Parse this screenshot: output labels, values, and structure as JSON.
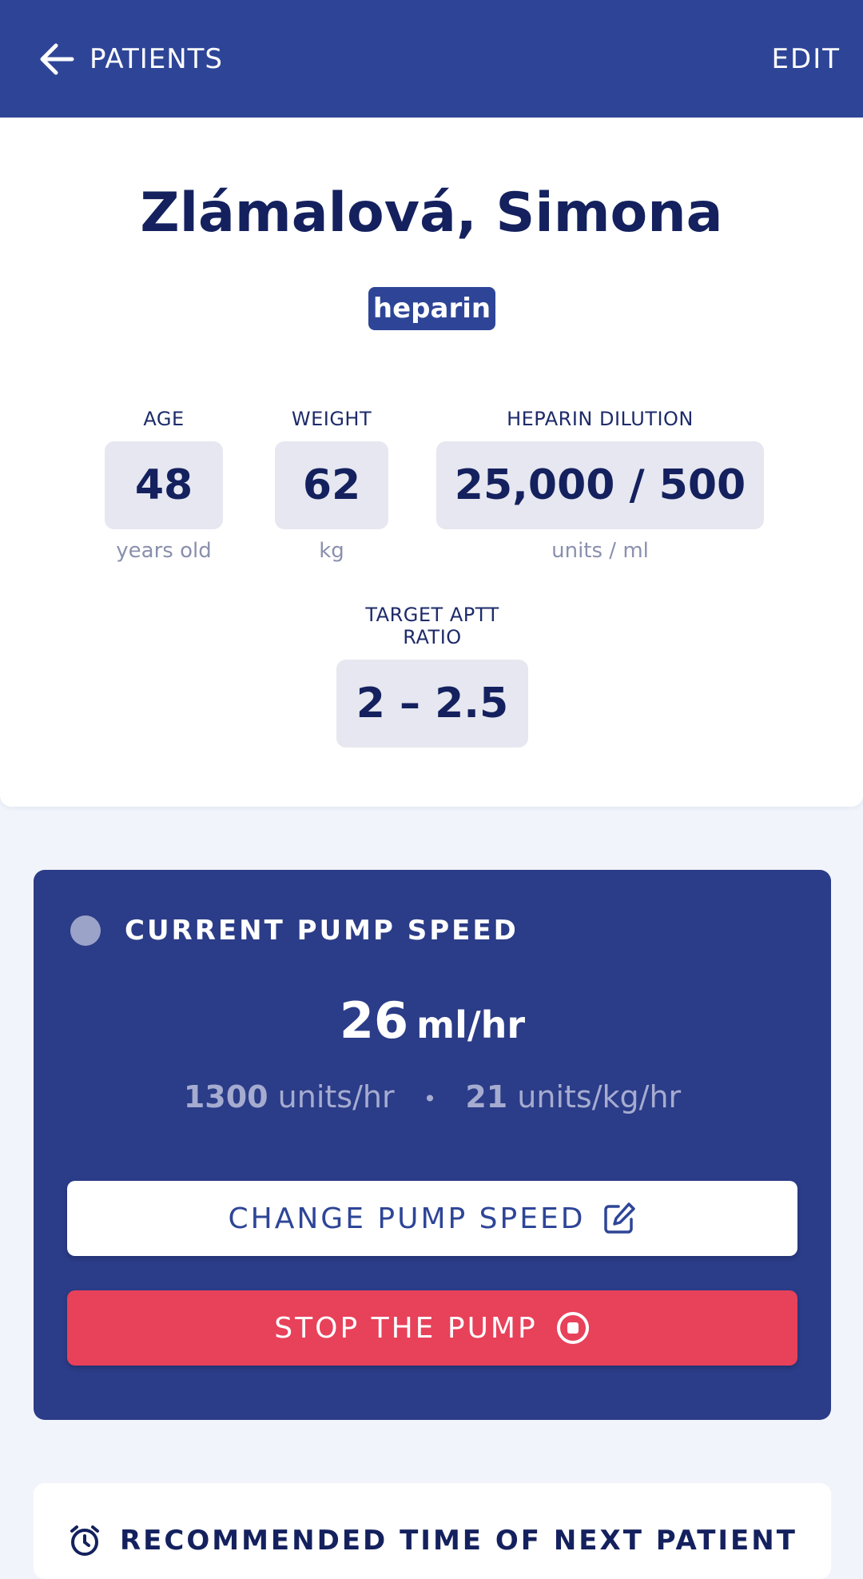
{
  "header": {
    "back_label": "PATIENTS",
    "edit_label": "EDIT"
  },
  "patient": {
    "name": "Zlámalová, Simona",
    "drug": "heparin",
    "age": {
      "label": "AGE",
      "value": "48",
      "unit": "years old"
    },
    "weight": {
      "label": "WEIGHT",
      "value": "62",
      "unit": "kg"
    },
    "dilution": {
      "label": "HEPARIN DILUTION",
      "value": "25,000 / 500",
      "unit": "units / ml"
    },
    "target": {
      "label": "TARGET APTT RATIO",
      "value": "2 – 2.5"
    }
  },
  "pump": {
    "title": "CURRENT PUMP SPEED",
    "rate_value": "26",
    "rate_unit": "ml/hr",
    "units_per_hr_value": "1300",
    "units_per_hr_unit": "units/hr",
    "separator": "•",
    "units_per_kg_value": "21",
    "units_per_kg_unit": "units/kg/hr",
    "change_label": "CHANGE PUMP SPEED",
    "stop_label": "STOP THE PUMP"
  },
  "next_card": {
    "title": "RECOMMENDED TIME OF NEXT PATIENT"
  },
  "colors": {
    "header_bg": "#2e4597",
    "pump_card_bg": "#2b3c88",
    "stop_button": "#e8415a",
    "status_dot": "#9ba3c9"
  }
}
